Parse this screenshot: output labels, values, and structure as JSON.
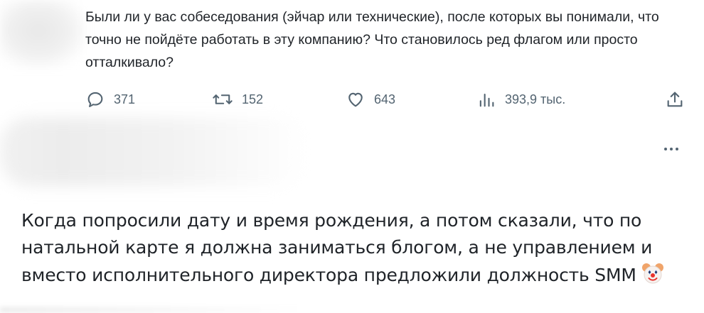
{
  "tweet": {
    "text": "Были ли у вас собеседования (эйчар или технические), после которых вы понимали, что точно не пойдёте работать в эту компанию? Что становилось ред флагом или просто отталкивало?",
    "actions": {
      "reply_count": "371",
      "retweet_count": "152",
      "like_count": "643",
      "views_count": "393,9 тыс."
    }
  },
  "reply": {
    "text": "Когда попросили дату и время рождения, а потом сказали, что по натальной карте я должна заниматься блогом, а не управлением и вместо исполнительного директора предложили должность SMM",
    "emoji_icon": "clown-face-icon"
  },
  "colors": {
    "text": "#1f2328",
    "muted": "#536471",
    "background": "#ffffff"
  }
}
